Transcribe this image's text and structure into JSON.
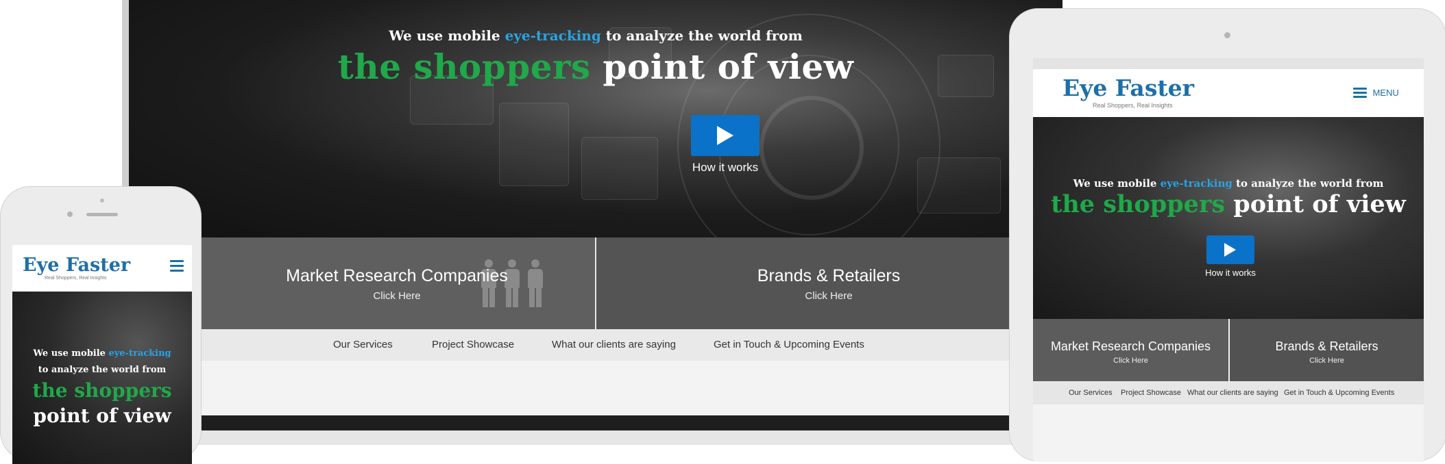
{
  "hero": {
    "line1_a": "We use mobile ",
    "line1_highlight": "eye-tracking",
    "line1_b": " to analyze the world from",
    "line2_highlight": "the shoppers",
    "line2_rest": " point of view",
    "play_label": "How it works",
    "play_icon": "play-icon"
  },
  "cards": {
    "left_title": "Market Research Companies",
    "left_sub": "Click Here",
    "right_title": "Brands & Retailers",
    "right_sub": "Click Here",
    "people_icon": "people-icon"
  },
  "nav": {
    "items": [
      "Our Services",
      "Project Showcase",
      "What our clients are saying",
      "Get in Touch & Upcoming Events"
    ]
  },
  "brand": {
    "name": "Eye Faster",
    "tagline": "Real Shoppers, Real Insights"
  },
  "phone": {
    "line1_a": "We use mobile ",
    "line1_highlight": "eye-tracking",
    "line2": "to analyze the world from",
    "line3": "the shoppers",
    "line4": "point of view",
    "menu_icon": "hamburger-icon"
  },
  "tablet": {
    "menu_label": "MENU",
    "menu_icon": "hamburger-icon"
  },
  "colors": {
    "accent_green": "#20a84a",
    "accent_blue": "#29a3e6",
    "brand_blue": "#1d6fa8",
    "button_blue": "#0b72c9"
  }
}
